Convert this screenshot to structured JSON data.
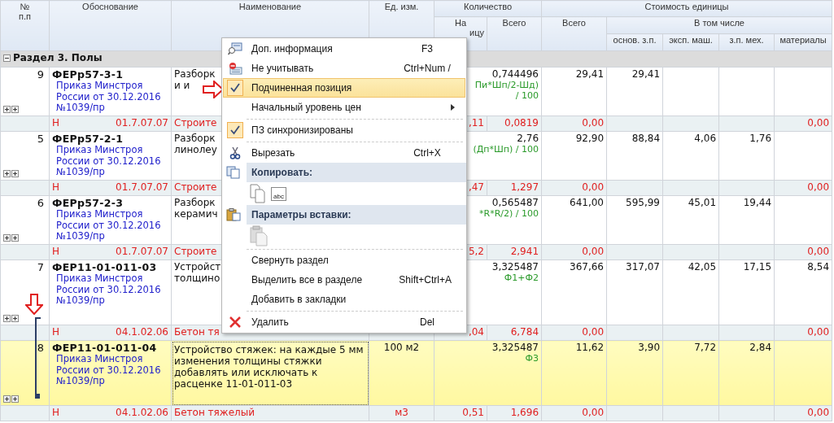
{
  "table": {
    "header": {
      "num": "№\nп.п",
      "basis": "Обоснование",
      "name": "Наименование",
      "unit": "Ед. изм.",
      "qty": "Количество",
      "qty_per": "На",
      "qty_per_cut": "ицу",
      "qty_total": "Всего",
      "cost": "Стоимость единицы",
      "cost_total": "Всего",
      "incl": "В том числе",
      "base_wage": "основ. з.п.",
      "machines": "эксп. маш.",
      "mech_wage": "з.п. мех.",
      "materials": "материалы"
    },
    "section": {
      "title": "Раздел 3. Полы",
      "expanded": true
    },
    "rows": [
      {
        "num": "9",
        "code": "ФЕРр57-3-1",
        "source": "Приказ Минстроя\nРоссии от 30.12.2016\n№1039/пр",
        "name": "Разборк\nи и",
        "qty_total": "0,744496",
        "formula": "Пи*Шп/2-Шд)\n/ 100",
        "cost_total": "29,41",
        "base_wage": "29,41",
        "selected": false,
        "sub": {
          "mark": "Н",
          "code": "01.7.07.07",
          "name": "Строите",
          "qty_per": ",11",
          "qty_total": "0,0819",
          "cost_total": "0,00",
          "materials": "0,00"
        }
      },
      {
        "num": "5",
        "code": "ФЕРр57-2-1",
        "source": "Приказ Минстроя\nРоссии от 30.12.2016\n№1039/пр",
        "name": "Разборк\nлинолеу",
        "qty_total": "2,76",
        "formula": "(Дп*Шп) / 100",
        "cost_total": "92,90",
        "base_wage": "88,84",
        "machines": "4,06",
        "mech_wage": "1,76",
        "selected": false,
        "sub": {
          "mark": "Н",
          "code": "01.7.07.07",
          "name": "Строите",
          "qty_per": ",47",
          "qty_total": "1,297",
          "cost_total": "0,00",
          "materials": "0,00"
        }
      },
      {
        "num": "6",
        "code": "ФЕРр57-2-3",
        "source": "Приказ Минстроя\nРоссии от 30.12.2016\n№1039/пр",
        "name": "Разборк\nкерамич",
        "qty_total": "0,565487",
        "formula": "*R*R/2) / 100",
        "cost_total": "641,00",
        "base_wage": "595,99",
        "machines": "45,01",
        "mech_wage": "19,44",
        "selected": false,
        "sub": {
          "mark": "Н",
          "code": "01.7.07.07",
          "name": "Строите",
          "qty_per": "5,2",
          "qty_total": "2,941",
          "cost_total": "0,00",
          "materials": "0,00"
        }
      },
      {
        "num": "7",
        "code": "ФЕР11-01-011-03",
        "source": "Приказ Минстроя\nРоссии от 30.12.2016\n№1039/пр",
        "name": "Устройст\nтолщино",
        "qty_total": "3,325487",
        "formula": "Ф1+Ф2",
        "cost_total": "367,66",
        "base_wage": "317,07",
        "machines": "42,05",
        "mech_wage": "17,15",
        "materials": "8,54",
        "selected": false,
        "sub": {
          "mark": "Н",
          "code": "04.1.02.06",
          "name": "Бетон тя",
          "qty_per": ",04",
          "qty_total": "6,784",
          "cost_total": "0,00",
          "materials": "0,00"
        }
      },
      {
        "num": "8",
        "code": "ФЕР11-01-011-04",
        "source": "Приказ Минстроя\nРоссии от 30.12.2016\n№1039/пр",
        "name": "Устройство стяжек: на каждые 5 мм изменения толщины стяжки добавлять или исключать к расценке 11-01-011-03",
        "unit": "100 м2",
        "qty_total": "3,325487",
        "formula": "Ф3",
        "cost_total": "11,62",
        "base_wage": "3,90",
        "machines": "7,72",
        "mech_wage": "2,84",
        "selected": true,
        "sub": {
          "mark": "Н",
          "code": "04.1.02.06",
          "name": "Бетон тяжелый",
          "unit": "м3",
          "qty_per": "0,51",
          "qty_total": "1,696",
          "cost_total": "0,00",
          "materials": "0,00"
        }
      }
    ]
  },
  "context_menu": {
    "items": [
      {
        "kind": "item",
        "label": "Доп. информация",
        "shortcut": "F3",
        "checked": false,
        "selected": false,
        "submenu": false
      },
      {
        "kind": "item",
        "label": "Не учитывать",
        "shortcut": "Ctrl+Num /",
        "checked": false,
        "selected": false,
        "submenu": false
      },
      {
        "kind": "item",
        "label": "Подчиненная позиция",
        "checked": true,
        "selected": true,
        "submenu": false
      },
      {
        "kind": "item",
        "label": "Начальный уровень цен",
        "checked": false,
        "selected": false,
        "submenu": true
      },
      {
        "kind": "separator"
      },
      {
        "kind": "item",
        "label": "ПЗ синхронизированы",
        "checked": true,
        "selected": false,
        "submenu": false
      },
      {
        "kind": "separator"
      },
      {
        "kind": "item",
        "label": "Вырезать",
        "shortcut": "Ctrl+X",
        "checked": false,
        "selected": false,
        "submenu": false
      },
      {
        "kind": "header",
        "label": "Копировать:"
      },
      {
        "kind": "copy_options",
        "text_label": "abc"
      },
      {
        "kind": "header",
        "label": "Параметры вставки:"
      },
      {
        "kind": "paste_options"
      },
      {
        "kind": "separator"
      },
      {
        "kind": "item",
        "label": "Свернуть раздел",
        "checked": false,
        "selected": false,
        "submenu": false
      },
      {
        "kind": "item",
        "label": "Выделить все в разделе",
        "shortcut": "Shift+Ctrl+A",
        "checked": false,
        "selected": false,
        "submenu": false
      },
      {
        "kind": "item",
        "label": "Добавить в закладки",
        "checked": false,
        "selected": false,
        "submenu": false
      },
      {
        "kind": "separator"
      },
      {
        "kind": "item",
        "label": "Удалить",
        "shortcut": "Del",
        "checked": false,
        "selected": false,
        "submenu": false
      }
    ]
  }
}
